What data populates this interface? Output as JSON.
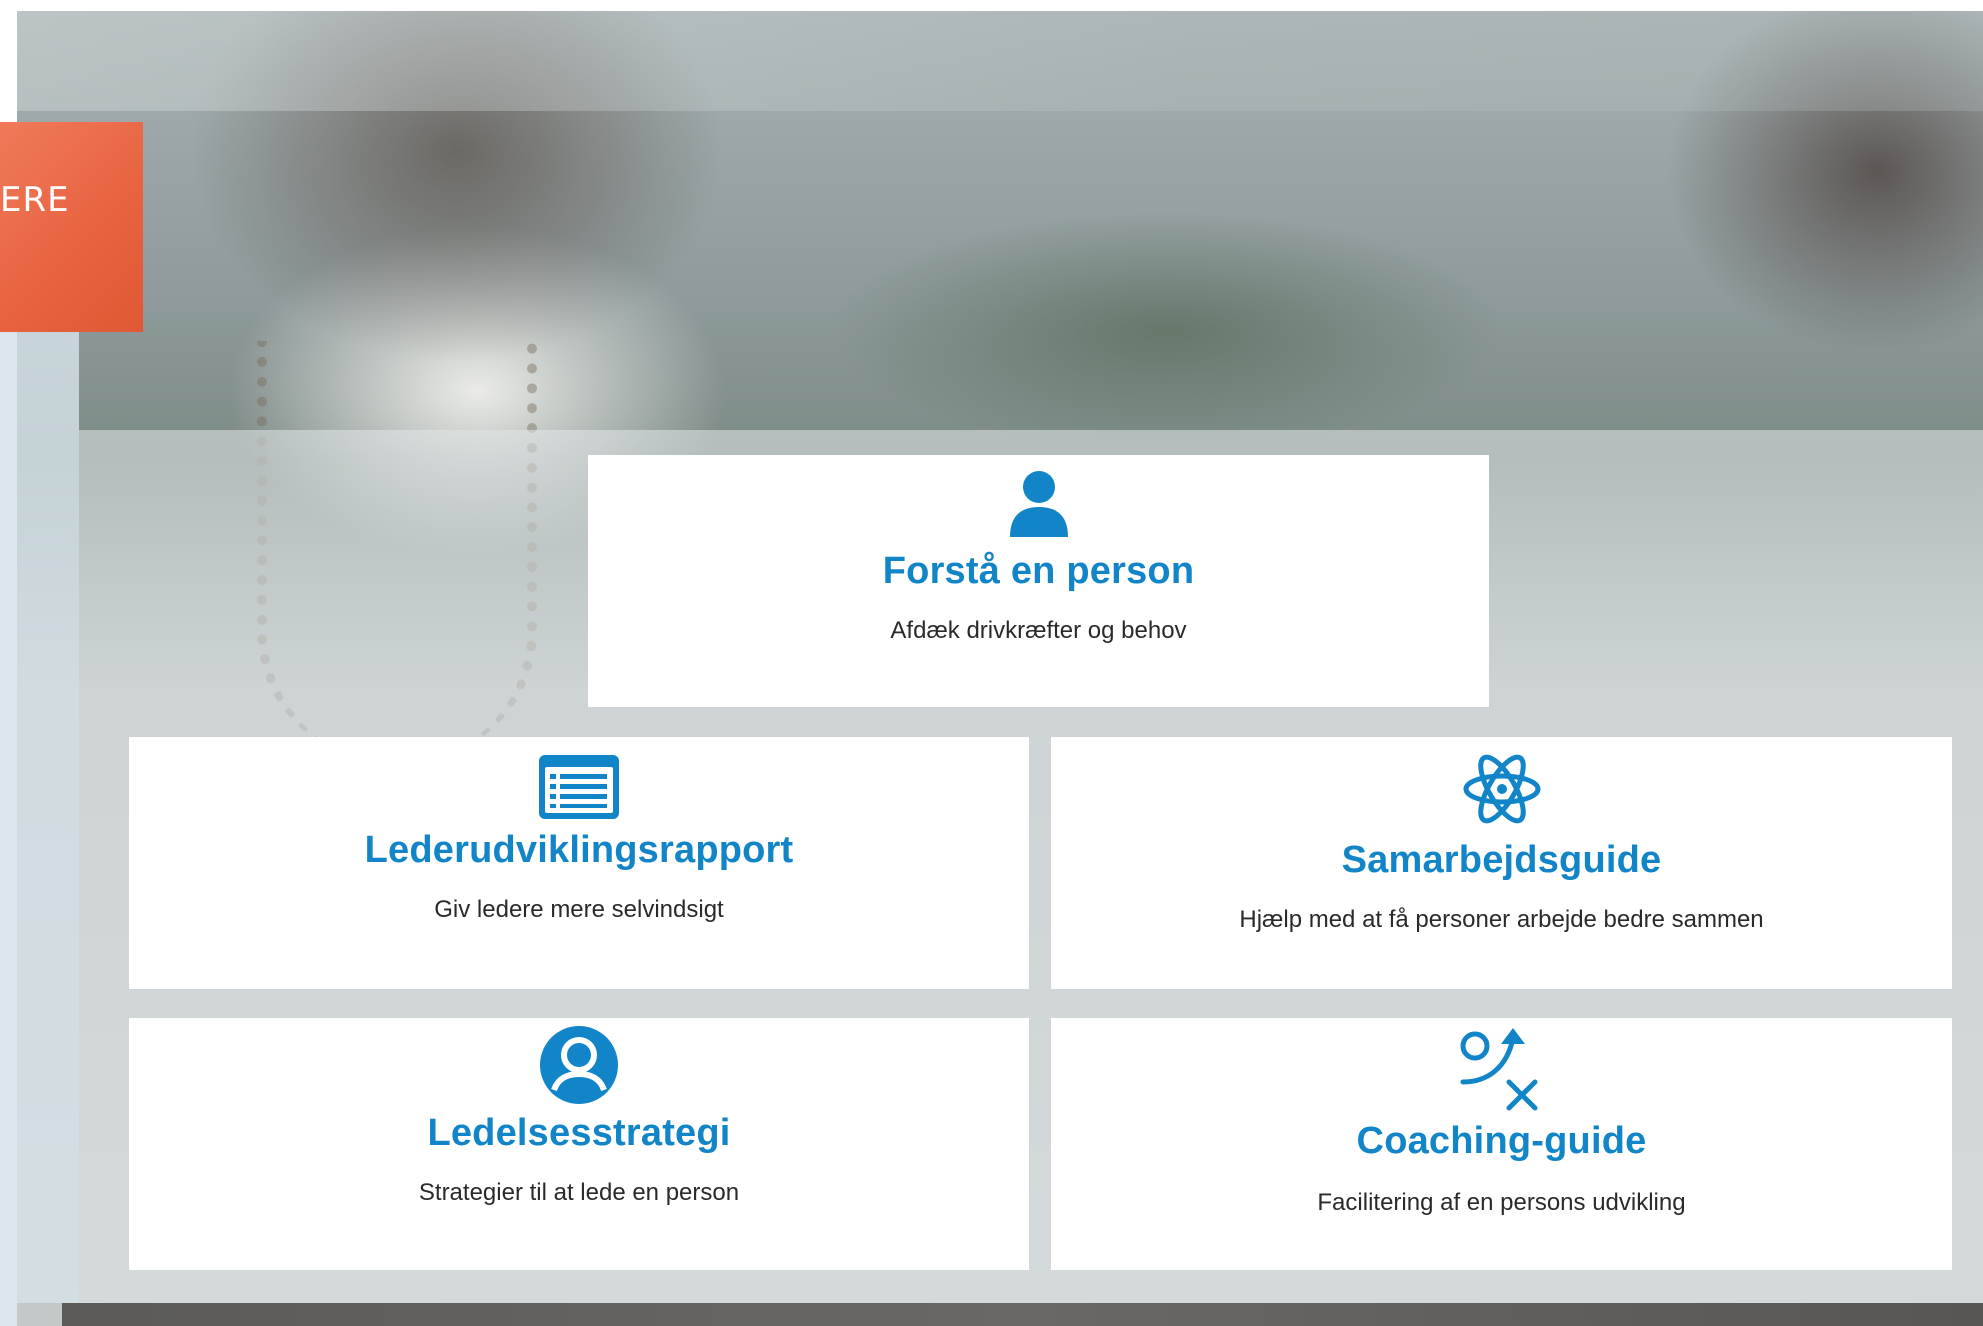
{
  "side_tab": {
    "label": "ERE"
  },
  "cards": [
    {
      "icon": "person-icon",
      "title": "Forstå en person",
      "subtitle": "Afdæk drivkræfter og behov"
    },
    {
      "icon": "report-list-icon",
      "title": "Lederudviklingsrapport",
      "subtitle": "Giv ledere mere selvindsigt"
    },
    {
      "icon": "atom-icon",
      "title": "Samarbejdsguide",
      "subtitle": "Hjælp med at få personer arbejde bedre sammen"
    },
    {
      "icon": "user-circle-icon",
      "title": "Ledelsesstrategi",
      "subtitle": "Strategier til at lede en person"
    },
    {
      "icon": "coaching-play-icon",
      "title": "Coaching-guide",
      "subtitle": "Facilitering af en persons udvikling"
    }
  ],
  "colors": {
    "accent": "#1185c7",
    "tab": "#e8623f",
    "text": "#2a2a2a"
  }
}
